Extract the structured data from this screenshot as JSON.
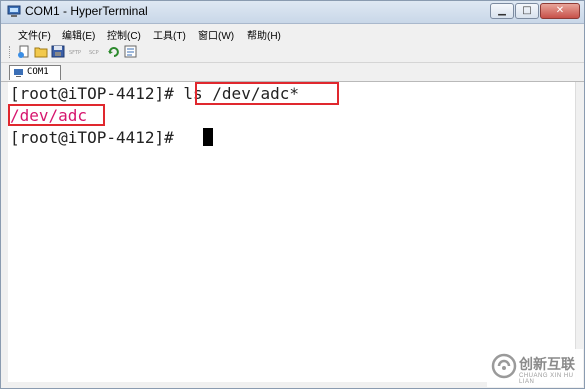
{
  "window": {
    "title": "COM1 - HyperTerminal",
    "controls": {
      "minimize": "▁",
      "maximize": "□",
      "close": "✕"
    }
  },
  "menu": [
    {
      "label": "文件(F)"
    },
    {
      "label": "编辑(E)"
    },
    {
      "label": "控制(C)"
    },
    {
      "label": "工具(T)"
    },
    {
      "label": "窗口(W)"
    },
    {
      "label": "帮助(H)"
    }
  ],
  "toolbar": {
    "icons": [
      "new-icon",
      "open-icon",
      "save-icon",
      "sftp-icon",
      "scp-icon",
      "reconnect-icon",
      "properties-icon"
    ],
    "sftp_label": "SFTP",
    "scp_label": "SCP"
  },
  "tabs": [
    {
      "label": "COM1",
      "icon": "serial-port-icon"
    }
  ],
  "terminal": {
    "line1_prompt": "[root@iTOP-4412]# ",
    "line1_command": "ls /dev/adc*",
    "line2_output": "/dev/adc",
    "line3_prompt": "[root@iTOP-4412]# "
  },
  "watermark": {
    "chinese": "创新互联",
    "english": "CHUANG XIN HU LIAN"
  },
  "colors": {
    "highlight_box": "#e0282e",
    "output_text": "#d6166e",
    "terminal_bg": "#ffffff"
  }
}
